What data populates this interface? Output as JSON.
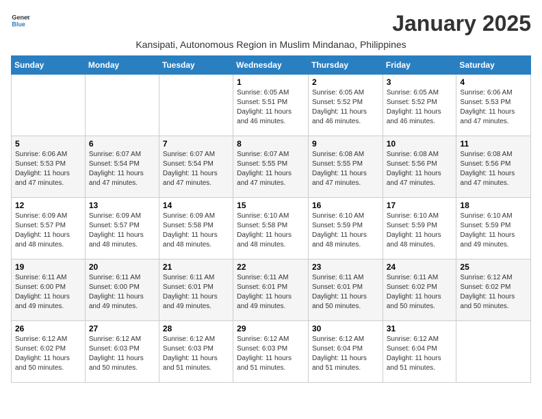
{
  "logo": {
    "line1": "General",
    "line2": "Blue"
  },
  "title": "January 2025",
  "subtitle": "Kansipati, Autonomous Region in Muslim Mindanao, Philippines",
  "weekdays": [
    "Sunday",
    "Monday",
    "Tuesday",
    "Wednesday",
    "Thursday",
    "Friday",
    "Saturday"
  ],
  "weeks": [
    [
      {
        "day": "",
        "sunrise": "",
        "sunset": "",
        "daylight": ""
      },
      {
        "day": "",
        "sunrise": "",
        "sunset": "",
        "daylight": ""
      },
      {
        "day": "",
        "sunrise": "",
        "sunset": "",
        "daylight": ""
      },
      {
        "day": "1",
        "sunrise": "Sunrise: 6:05 AM",
        "sunset": "Sunset: 5:51 PM",
        "daylight": "Daylight: 11 hours and 46 minutes."
      },
      {
        "day": "2",
        "sunrise": "Sunrise: 6:05 AM",
        "sunset": "Sunset: 5:52 PM",
        "daylight": "Daylight: 11 hours and 46 minutes."
      },
      {
        "day": "3",
        "sunrise": "Sunrise: 6:05 AM",
        "sunset": "Sunset: 5:52 PM",
        "daylight": "Daylight: 11 hours and 46 minutes."
      },
      {
        "day": "4",
        "sunrise": "Sunrise: 6:06 AM",
        "sunset": "Sunset: 5:53 PM",
        "daylight": "Daylight: 11 hours and 47 minutes."
      }
    ],
    [
      {
        "day": "5",
        "sunrise": "Sunrise: 6:06 AM",
        "sunset": "Sunset: 5:53 PM",
        "daylight": "Daylight: 11 hours and 47 minutes."
      },
      {
        "day": "6",
        "sunrise": "Sunrise: 6:07 AM",
        "sunset": "Sunset: 5:54 PM",
        "daylight": "Daylight: 11 hours and 47 minutes."
      },
      {
        "day": "7",
        "sunrise": "Sunrise: 6:07 AM",
        "sunset": "Sunset: 5:54 PM",
        "daylight": "Daylight: 11 hours and 47 minutes."
      },
      {
        "day": "8",
        "sunrise": "Sunrise: 6:07 AM",
        "sunset": "Sunset: 5:55 PM",
        "daylight": "Daylight: 11 hours and 47 minutes."
      },
      {
        "day": "9",
        "sunrise": "Sunrise: 6:08 AM",
        "sunset": "Sunset: 5:55 PM",
        "daylight": "Daylight: 11 hours and 47 minutes."
      },
      {
        "day": "10",
        "sunrise": "Sunrise: 6:08 AM",
        "sunset": "Sunset: 5:56 PM",
        "daylight": "Daylight: 11 hours and 47 minutes."
      },
      {
        "day": "11",
        "sunrise": "Sunrise: 6:08 AM",
        "sunset": "Sunset: 5:56 PM",
        "daylight": "Daylight: 11 hours and 47 minutes."
      }
    ],
    [
      {
        "day": "12",
        "sunrise": "Sunrise: 6:09 AM",
        "sunset": "Sunset: 5:57 PM",
        "daylight": "Daylight: 11 hours and 48 minutes."
      },
      {
        "day": "13",
        "sunrise": "Sunrise: 6:09 AM",
        "sunset": "Sunset: 5:57 PM",
        "daylight": "Daylight: 11 hours and 48 minutes."
      },
      {
        "day": "14",
        "sunrise": "Sunrise: 6:09 AM",
        "sunset": "Sunset: 5:58 PM",
        "daylight": "Daylight: 11 hours and 48 minutes."
      },
      {
        "day": "15",
        "sunrise": "Sunrise: 6:10 AM",
        "sunset": "Sunset: 5:58 PM",
        "daylight": "Daylight: 11 hours and 48 minutes."
      },
      {
        "day": "16",
        "sunrise": "Sunrise: 6:10 AM",
        "sunset": "Sunset: 5:59 PM",
        "daylight": "Daylight: 11 hours and 48 minutes."
      },
      {
        "day": "17",
        "sunrise": "Sunrise: 6:10 AM",
        "sunset": "Sunset: 5:59 PM",
        "daylight": "Daylight: 11 hours and 48 minutes."
      },
      {
        "day": "18",
        "sunrise": "Sunrise: 6:10 AM",
        "sunset": "Sunset: 5:59 PM",
        "daylight": "Daylight: 11 hours and 49 minutes."
      }
    ],
    [
      {
        "day": "19",
        "sunrise": "Sunrise: 6:11 AM",
        "sunset": "Sunset: 6:00 PM",
        "daylight": "Daylight: 11 hours and 49 minutes."
      },
      {
        "day": "20",
        "sunrise": "Sunrise: 6:11 AM",
        "sunset": "Sunset: 6:00 PM",
        "daylight": "Daylight: 11 hours and 49 minutes."
      },
      {
        "day": "21",
        "sunrise": "Sunrise: 6:11 AM",
        "sunset": "Sunset: 6:01 PM",
        "daylight": "Daylight: 11 hours and 49 minutes."
      },
      {
        "day": "22",
        "sunrise": "Sunrise: 6:11 AM",
        "sunset": "Sunset: 6:01 PM",
        "daylight": "Daylight: 11 hours and 49 minutes."
      },
      {
        "day": "23",
        "sunrise": "Sunrise: 6:11 AM",
        "sunset": "Sunset: 6:01 PM",
        "daylight": "Daylight: 11 hours and 50 minutes."
      },
      {
        "day": "24",
        "sunrise": "Sunrise: 6:11 AM",
        "sunset": "Sunset: 6:02 PM",
        "daylight": "Daylight: 11 hours and 50 minutes."
      },
      {
        "day": "25",
        "sunrise": "Sunrise: 6:12 AM",
        "sunset": "Sunset: 6:02 PM",
        "daylight": "Daylight: 11 hours and 50 minutes."
      }
    ],
    [
      {
        "day": "26",
        "sunrise": "Sunrise: 6:12 AM",
        "sunset": "Sunset: 6:02 PM",
        "daylight": "Daylight: 11 hours and 50 minutes."
      },
      {
        "day": "27",
        "sunrise": "Sunrise: 6:12 AM",
        "sunset": "Sunset: 6:03 PM",
        "daylight": "Daylight: 11 hours and 50 minutes."
      },
      {
        "day": "28",
        "sunrise": "Sunrise: 6:12 AM",
        "sunset": "Sunset: 6:03 PM",
        "daylight": "Daylight: 11 hours and 51 minutes."
      },
      {
        "day": "29",
        "sunrise": "Sunrise: 6:12 AM",
        "sunset": "Sunset: 6:03 PM",
        "daylight": "Daylight: 11 hours and 51 minutes."
      },
      {
        "day": "30",
        "sunrise": "Sunrise: 6:12 AM",
        "sunset": "Sunset: 6:04 PM",
        "daylight": "Daylight: 11 hours and 51 minutes."
      },
      {
        "day": "31",
        "sunrise": "Sunrise: 6:12 AM",
        "sunset": "Sunset: 6:04 PM",
        "daylight": "Daylight: 11 hours and 51 minutes."
      },
      {
        "day": "",
        "sunrise": "",
        "sunset": "",
        "daylight": ""
      }
    ]
  ]
}
